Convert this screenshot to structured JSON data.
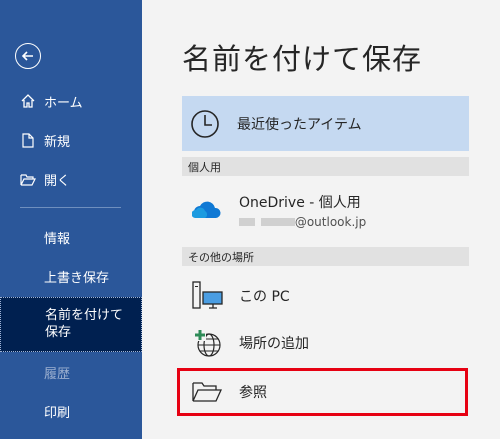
{
  "sidebar": {
    "items": [
      {
        "label": "ホーム"
      },
      {
        "label": "新規"
      },
      {
        "label": "開く"
      },
      {
        "label": "情報"
      },
      {
        "label": "上書き保存"
      },
      {
        "label": "名前を付けて保存"
      },
      {
        "label": "履歴"
      },
      {
        "label": "印刷"
      }
    ],
    "bg_color": "#2b579a",
    "selected_color": "#002050"
  },
  "main": {
    "title": "名前を付けて保存",
    "recent": {
      "label": "最近使ったアイテム"
    },
    "personal_header": "個人用",
    "onedrive": {
      "label": "OneDrive - 個人用",
      "account_suffix": "@outlook.jp"
    },
    "other_header": "その他の場所",
    "this_pc": {
      "label": "この PC"
    },
    "add_place": {
      "label": "場所の追加"
    },
    "browse": {
      "label": "参照"
    },
    "highlight_color": "#e60012"
  }
}
